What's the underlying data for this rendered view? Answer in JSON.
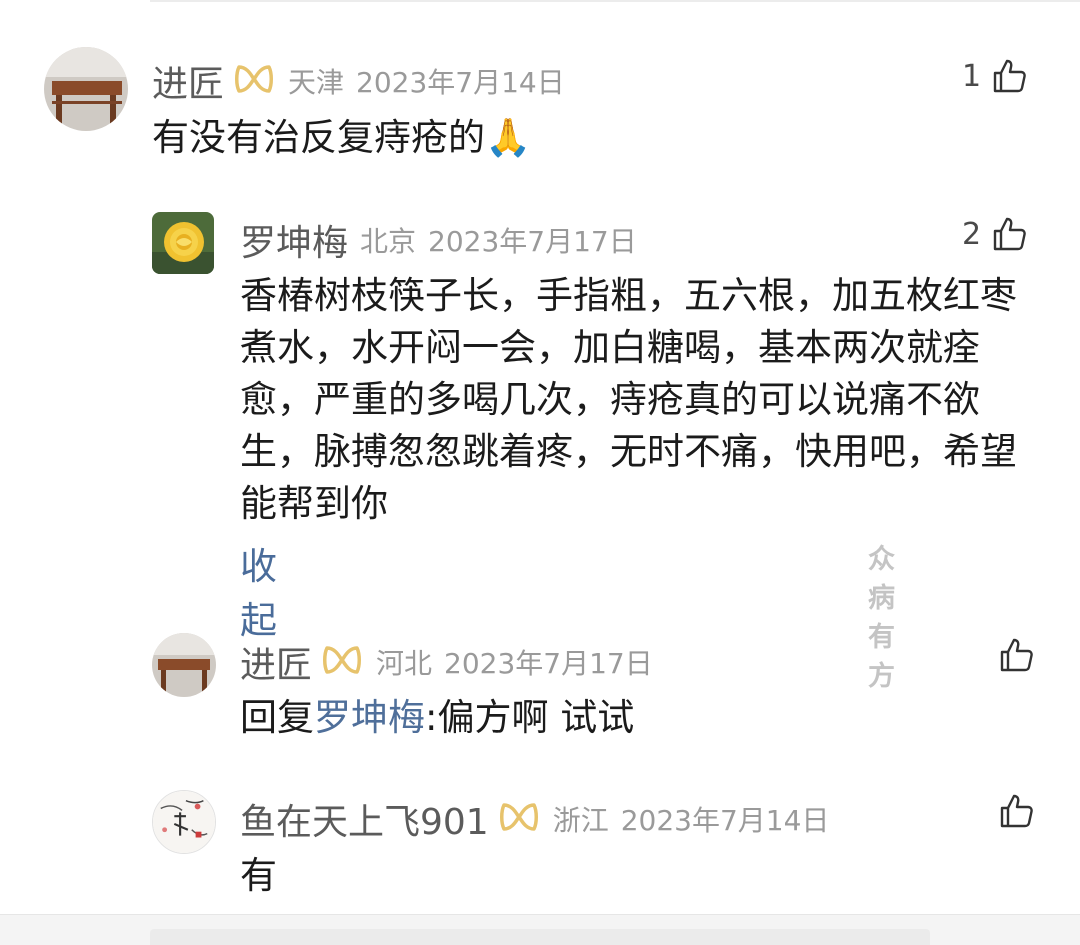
{
  "comments": [
    {
      "name": "进匠",
      "location": "天津",
      "date": "2023年7月14日",
      "likes": "1",
      "text": "有没有治反复痔疮的🙏"
    },
    {
      "name": "罗坤梅",
      "location": "北京",
      "date": "2023年7月17日",
      "likes": "2",
      "text": "香椿树枝筷子长，手指粗，五六根，加五枚红枣煮水，水开闷一会，加白糖喝，基本两次就痊愈，严重的多喝几次，痔疮真的可以说痛不欲生，脉搏怱怱跳着疼，无时不痛，快用吧，希望能帮到你",
      "collapse_label": "收起"
    },
    {
      "name": "进匠",
      "location": "河北",
      "date": "2023年7月17日",
      "reply_prefix": "回复",
      "reply_to": "罗坤梅",
      "reply_text": ":偏方啊 试试"
    },
    {
      "name": "鱼在天上飞901",
      "location": "浙江",
      "date": "2023年7月14日",
      "text": "有"
    }
  ],
  "watermark": "众病有方",
  "icons": {
    "like": "thumbs-up-icon",
    "badge": "vip-badge-icon",
    "emoji": "folded-hands-emoji"
  },
  "colors": {
    "name": "#5b5b5b",
    "meta": "#9a9a9a",
    "badge": "#e7c36c",
    "link": "#4a6c9a"
  }
}
